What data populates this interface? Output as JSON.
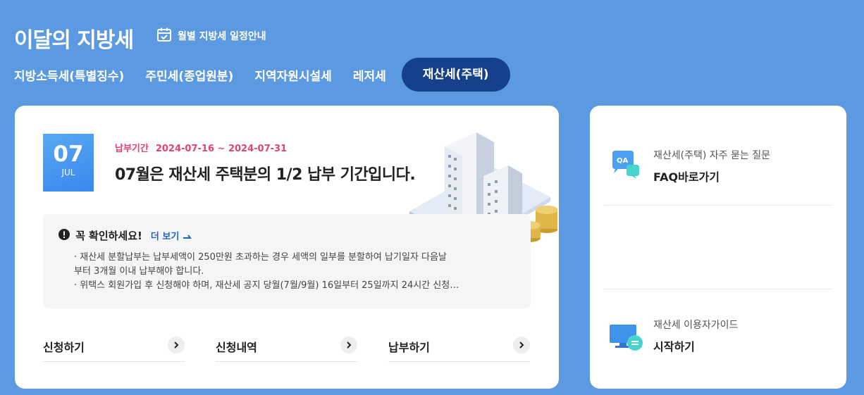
{
  "header": {
    "title": "이달의 지방세",
    "schedule_label": "월별 지방세 일정안내"
  },
  "tabs": [
    {
      "label": "지방소득세(특별징수)"
    },
    {
      "label": "주민세(종업원분)"
    },
    {
      "label": "지역자원시설세"
    },
    {
      "label": "레저세"
    },
    {
      "label": "재산세(주택)",
      "active": true
    }
  ],
  "main": {
    "date_day": "07",
    "date_month": "JUL",
    "period_label": "납부기간",
    "period_dates": "2024-07-16 ~ 2024-07-31",
    "headline": "07월은 재산세 주택분의 1/2 납부 기간입니다.",
    "notice": {
      "title": "꼭 확인하세요!",
      "more_label": "더 보기",
      "lines": [
        "· 재산세 분할납부는 납부세액이 250만원 초과하는 경우 세액의 일부를 분할하여 납기일자 다음날",
        "부터 3개월 이내 납부해야 합니다.",
        "· 위택스 회원가입 후 신청해야 하며, 재산세 공지 당월(7월/9월) 16일부터 25일까지 24시간 신청…"
      ]
    },
    "actions": [
      {
        "label": "신청하기"
      },
      {
        "label": "신청내역"
      },
      {
        "label": "납부하기"
      }
    ]
  },
  "side": {
    "faq": {
      "icon_text": "QA",
      "sub": "재산세(주택) 자주 묻는 질문",
      "main": "FAQ바로가기"
    },
    "guide": {
      "sub": "재산세 이용자가이드",
      "main": "시작하기"
    }
  },
  "colors": {
    "background": "#5b9ae0",
    "active_tab": "#17408a",
    "period_accent": "#e0456f",
    "link": "#1f64c9"
  }
}
